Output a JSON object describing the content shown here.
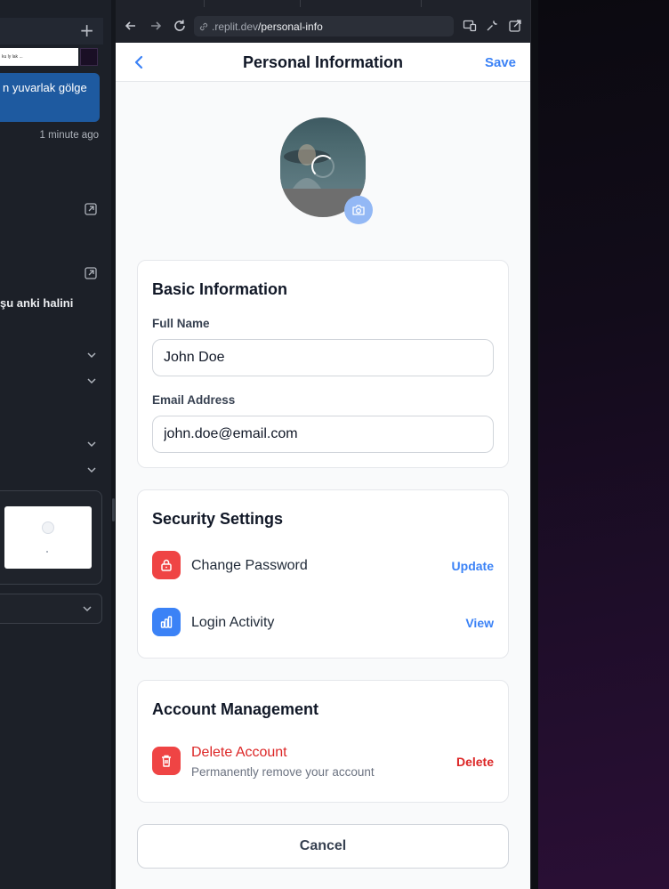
{
  "sidebar": {
    "thumb_caption": "ku ly lak ...",
    "message_text": "n yuvarlak gölge",
    "message_time": "1 minute ago",
    "fragment_text": "şu anki halini"
  },
  "browser": {
    "url_host": ".replit.dev",
    "url_path": "/personal-info"
  },
  "header": {
    "title": "Personal Information",
    "save_label": "Save"
  },
  "basic_info": {
    "title": "Basic Information",
    "full_name_label": "Full Name",
    "full_name_value": "John Doe",
    "email_label": "Email Address",
    "email_value": "john.doe@email.com"
  },
  "security": {
    "title": "Security Settings",
    "items": [
      {
        "label": "Change Password",
        "action": "Update",
        "icon": "lock-icon",
        "icon_color": "#ef4444"
      },
      {
        "label": "Login Activity",
        "action": "View",
        "icon": "chart-icon",
        "icon_color": "#3b82f6"
      }
    ]
  },
  "account": {
    "title": "Account Management",
    "delete_label": "Delete Account",
    "delete_sub": "Permanently remove your account",
    "delete_action": "Delete",
    "icon": "trash-icon",
    "icon_color": "#ef4444"
  },
  "cancel_label": "Cancel",
  "colors": {
    "accent": "#3b82f6",
    "danger": "#dc2626"
  }
}
